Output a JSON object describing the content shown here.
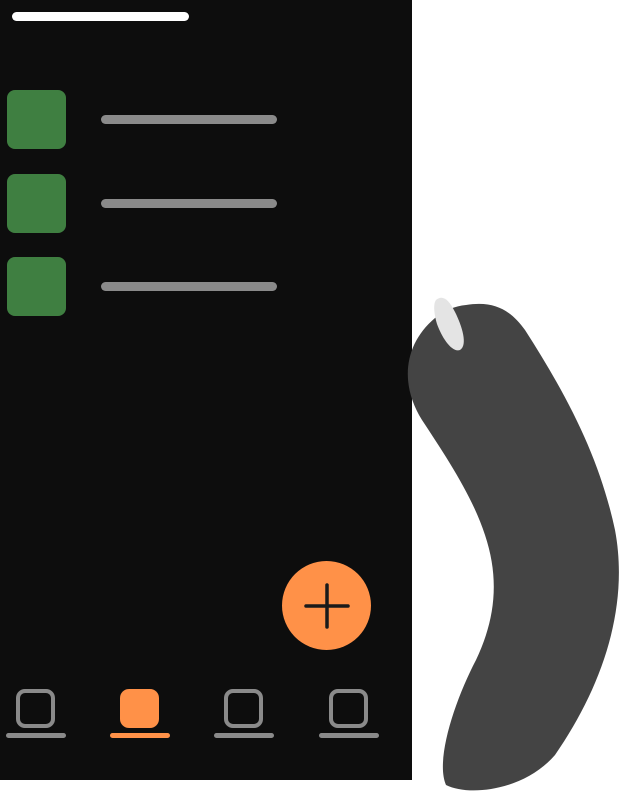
{
  "colors": {
    "background": "#0d0d0d",
    "accent": "#ff9148",
    "thumbnail": "#3f7f41",
    "placeholder_line": "#8a8a8a",
    "inactive_tab": "#8a8a8a",
    "hand": "#444444"
  },
  "header": {
    "title_placeholder": ""
  },
  "list": {
    "items": [
      {
        "icon": "green-square-thumbnail"
      },
      {
        "icon": "green-square-thumbnail"
      },
      {
        "icon": "green-square-thumbnail"
      }
    ]
  },
  "fab": {
    "icon": "plus-icon"
  },
  "tab_bar": {
    "tabs": [
      {
        "icon": "square-outline-icon",
        "active": false
      },
      {
        "icon": "square-filled-icon",
        "active": true
      },
      {
        "icon": "square-outline-icon",
        "active": false
      },
      {
        "icon": "square-outline-icon",
        "active": false
      }
    ]
  },
  "overlay": {
    "icon": "pointing-finger"
  }
}
